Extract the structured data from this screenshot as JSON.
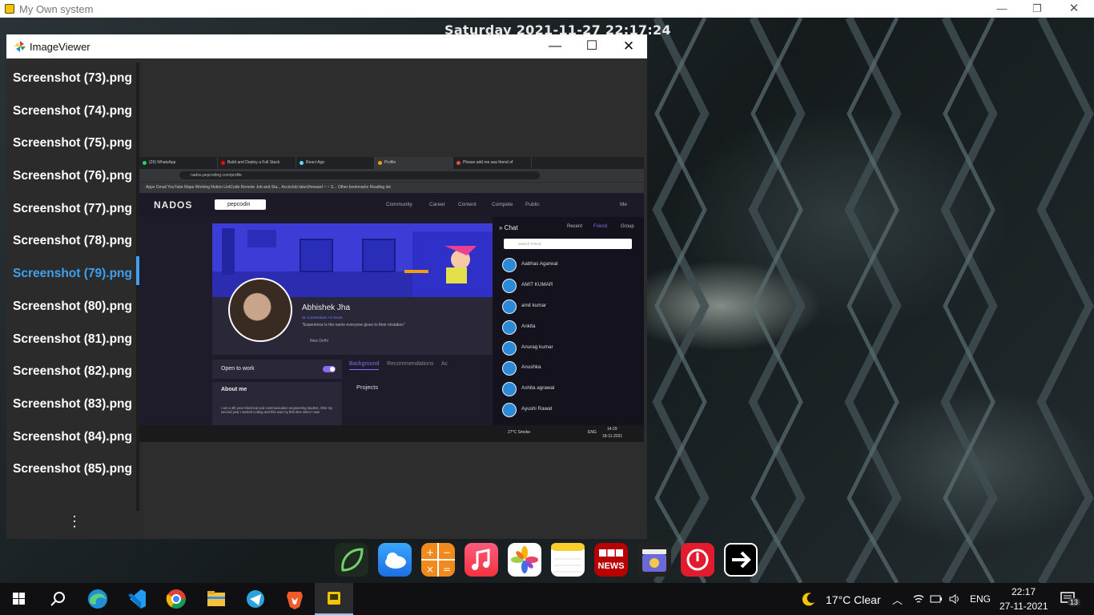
{
  "outer_window": {
    "title": "My Own system"
  },
  "desktop_clock": "Saturday    2021-11-27    22:17:24",
  "viewer": {
    "title": "ImageViewer",
    "files": [
      "Screenshot (73).png",
      "Screenshot (74).png",
      "Screenshot (75).png",
      "Screenshot (76).png",
      "Screenshot (77).png",
      "Screenshot (78).png",
      "Screenshot (79).png",
      "Screenshot (80).png",
      "Screenshot (81).png",
      "Screenshot (82).png",
      "Screenshot (83).png",
      "Screenshot (84).png",
      "Screenshot (85).png"
    ],
    "selected_file": "Screenshot (79).png"
  },
  "preview": {
    "tabs": [
      "(26) WhatsApp",
      "Build and Deploy a Full Stack",
      "React App",
      "Profile",
      "Please add me asa friend of"
    ],
    "url": "nados.pepcoding.com/profile",
    "bookmarks": "Apps   Gmail   YouTube   Maps   Working   Notion   LintCode   Remote Job and Sta...   AccioJob   takeUforward ~ ~ S...                              Other bookmarks   Reading list",
    "logo": "NADOS",
    "search": "pepcodin",
    "nav": [
      "Community",
      "Career",
      "Content",
      "Compete",
      "Public"
    ],
    "me": "Me",
    "profile_name": "Abhishek Jha",
    "connections": "31 Connections  •  0 Score",
    "quote": "\"Experience is the name everyone gives to their mistakes\"",
    "location": "New Delhi",
    "open_to_work": "Open to work",
    "about_title": "About me",
    "about_text": "I am a 4th year Electrical and communication engineering student. After my second year I started coding and this was my first time when I was",
    "tabs_row": [
      "Background",
      "Recommendations",
      "Ac"
    ],
    "projects": "Projects",
    "chat": {
      "title": "Chat",
      "tabs": [
        "Recent",
        "Friend",
        "Group"
      ],
      "search_placeholder": "Search Friend",
      "friends": [
        "Aabhas Agarwal",
        "AMIT KUMAR",
        "amit kumar",
        "Ankita",
        "Anurag kumar",
        "Anushka",
        "Ashita agrawal",
        "Ayushi Rawat"
      ]
    },
    "taskbar": {
      "weather": "27°C  Smoke",
      "lang": "ENG",
      "time": "14:29",
      "date": "18-11-2021"
    }
  },
  "taskbar": {
    "weather": "17°C  Clear",
    "lang": "ENG",
    "time": "22:17",
    "date": "27-11-2021",
    "notifications": "13"
  }
}
